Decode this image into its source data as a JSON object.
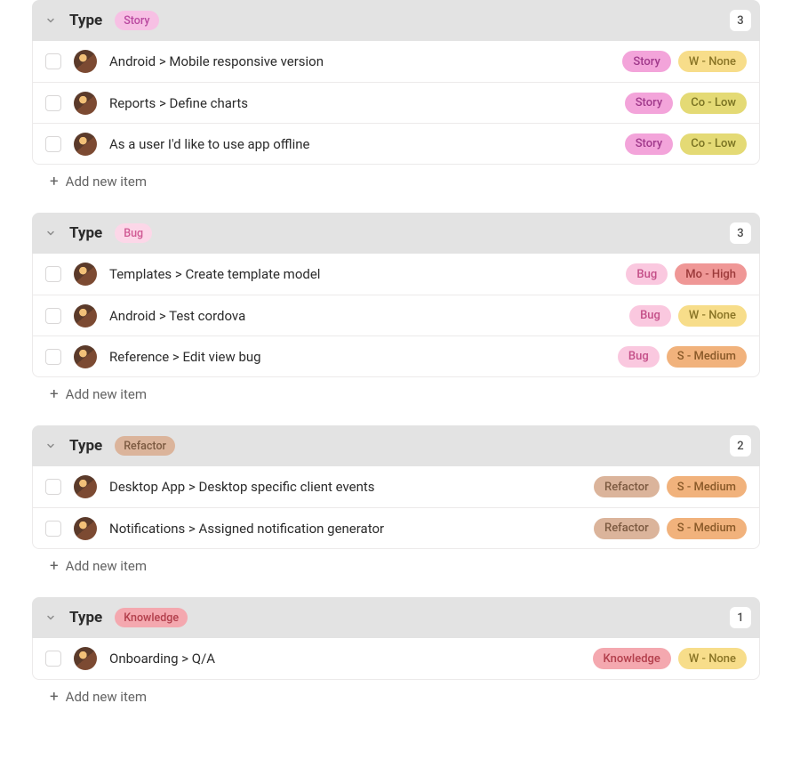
{
  "common": {
    "group_label": "Type",
    "add_new": "Add new item"
  },
  "groups": [
    {
      "type_pill": {
        "text": "Story",
        "class": "c-story-h"
      },
      "count": "3",
      "items": [
        {
          "title": "Android > Mobile responsive version",
          "tags": [
            {
              "text": "Story",
              "class": "c-story"
            },
            {
              "text": "W - None",
              "class": "c-none"
            }
          ]
        },
        {
          "title": "Reports > Define charts",
          "tags": [
            {
              "text": "Story",
              "class": "c-story"
            },
            {
              "text": "Co - Low",
              "class": "c-low"
            }
          ]
        },
        {
          "title": "As a user I'd like to use app offline",
          "tags": [
            {
              "text": "Story",
              "class": "c-story"
            },
            {
              "text": "Co - Low",
              "class": "c-low"
            }
          ]
        }
      ]
    },
    {
      "type_pill": {
        "text": "Bug",
        "class": "c-bug-h"
      },
      "count": "3",
      "items": [
        {
          "title": "Templates > Create template model",
          "tags": [
            {
              "text": "Bug",
              "class": "c-bug"
            },
            {
              "text": "Mo - High",
              "class": "c-high"
            }
          ]
        },
        {
          "title": "Android > Test cordova",
          "tags": [
            {
              "text": "Bug",
              "class": "c-bug"
            },
            {
              "text": "W - None",
              "class": "c-none"
            }
          ]
        },
        {
          "title": "Reference > Edit view bug",
          "tags": [
            {
              "text": "Bug",
              "class": "c-bug"
            },
            {
              "text": "S - Medium",
              "class": "c-medium"
            }
          ]
        }
      ]
    },
    {
      "type_pill": {
        "text": "Refactor",
        "class": "c-refactor"
      },
      "count": "2",
      "items": [
        {
          "title": "Desktop App > Desktop specific client events",
          "tags": [
            {
              "text": "Refactor",
              "class": "c-refactor"
            },
            {
              "text": "S - Medium",
              "class": "c-medium"
            }
          ]
        },
        {
          "title": "Notifications > Assigned notification generator",
          "tags": [
            {
              "text": "Refactor",
              "class": "c-refactor"
            },
            {
              "text": "S - Medium",
              "class": "c-medium"
            }
          ]
        }
      ]
    },
    {
      "type_pill": {
        "text": "Knowledge",
        "class": "c-knowledge"
      },
      "count": "1",
      "items": [
        {
          "title": "Onboarding > Q/A",
          "tags": [
            {
              "text": "Knowledge",
              "class": "c-knowledge"
            },
            {
              "text": "W - None",
              "class": "c-none"
            }
          ]
        }
      ]
    }
  ]
}
